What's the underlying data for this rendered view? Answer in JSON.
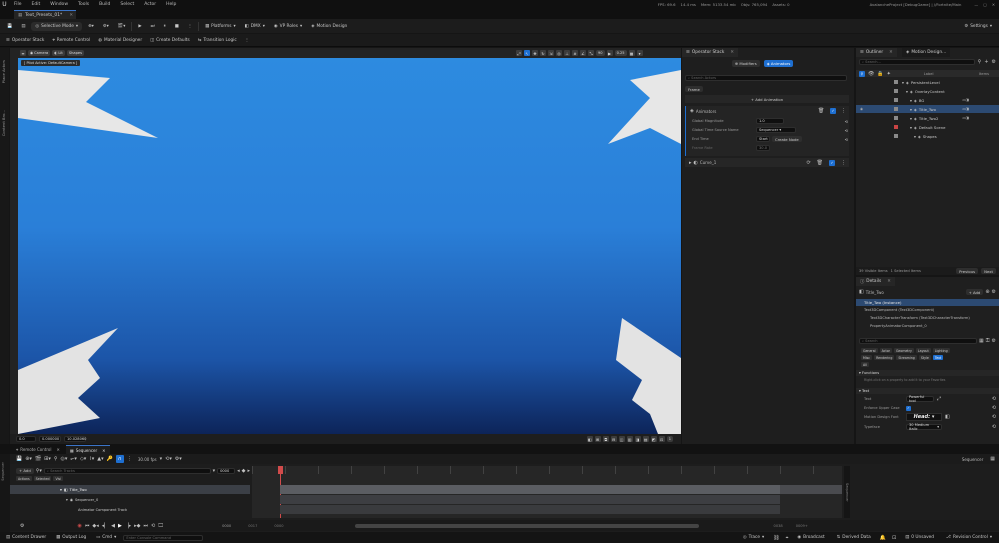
{
  "menubar": {
    "logo": "U",
    "items": [
      "File",
      "Edit",
      "Window",
      "Tools",
      "Build",
      "Select",
      "Actor",
      "Help"
    ],
    "stats": {
      "fps": "FPS: 69.6",
      "ms": "14.4 ms",
      "mem": "Mem: 5133.54 mb",
      "objs": "Objs: 765,094",
      "assets": "Assets: 0"
    },
    "project": "AvalancheProject [DebugGame] | //Fortnite/Main"
  },
  "level_tab": {
    "label": "Text_Presets_01*"
  },
  "toolbar": {
    "selective_mode": "Selective Mode",
    "platforms": "Platforms",
    "dmx": "DMX",
    "vp_roles": "VP Roles",
    "motion_design": "Motion Design",
    "settings": "Settings"
  },
  "toolbar2": {
    "items": [
      "Operator Stack",
      "Remote Control",
      "Material Designer",
      "Create Defaults",
      "Transition Logic"
    ]
  },
  "left_strip": {
    "top": "Place Actors",
    "bottom": "Content Bro..."
  },
  "viewport": {
    "camera_btn": "Camera",
    "lit_btn": "Lit",
    "shapes_btn": "Shapes",
    "pilot_label": "[ Pilot Active: DefaultCamera ]",
    "fov_value": "90",
    "speed_value": "0.25",
    "bottom": {
      "v1": "0.0",
      "v2": "0.000000",
      "v3": "10.028060",
      "zoom": "1"
    }
  },
  "operator_stack": {
    "tab": "Operator Stack",
    "modifiers_btn": "Modifiers",
    "animators_btn": "Animators",
    "search_placeholder": "Search Actors",
    "filter_label": "Frame",
    "add_animation": "+ Add Animation",
    "animators_section": "Animators",
    "global_magnitude_label": "Global Magnitude",
    "global_magnitude_value": "1.0",
    "global_time_source_label": "Global Time Source Name",
    "global_time_source_value": "Sequencer",
    "end_time_label": "End Time",
    "end_time_value": "Start",
    "create_node": "Create Node",
    "frame_rate_label": "Frame Rate",
    "frame_rate_value": "30.0",
    "curve_item": "Curve_1"
  },
  "outliner": {
    "tab1": "Outliner",
    "tab2": "Motion Design...",
    "search_placeholder": "Search...",
    "col_label": "Label",
    "col_items": "Items",
    "rows": [
      {
        "label": "PersistentLevel",
        "indent": 1,
        "selected": false,
        "red": false
      },
      {
        "label": "OverlayContent",
        "indent": 2,
        "selected": false,
        "red": false
      },
      {
        "label": "BG",
        "indent": 3,
        "selected": false,
        "red": false
      },
      {
        "label": "Title_Two",
        "indent": 3,
        "selected": true,
        "red": false
      },
      {
        "label": "Title_Two2",
        "indent": 3,
        "selected": false,
        "red": false
      },
      {
        "label": "Default Scene",
        "indent": 3,
        "selected": false,
        "red": true
      },
      {
        "label": "Shapes",
        "indent": 4,
        "selected": false,
        "red": false
      }
    ],
    "footer_left": "39 Visible Items",
    "footer_mid": "1 Selected Items",
    "prev_btn": "Previous",
    "next_btn": "Next"
  },
  "details": {
    "tab": "Details",
    "actor_name": "Title_Two",
    "add_btn": "+ Add",
    "instance_row": "Title_Two (Instance)",
    "components": [
      "Text3DComponent (Text3DComponent)",
      "Text3DCharacterTransform (Text3DCharacterTransform)",
      "PropertyAnimatorComponent_0"
    ],
    "search_placeholder": "Search",
    "chips_row1": [
      "General",
      "Actor",
      "Geometry",
      "Layout",
      "Lighting"
    ],
    "chips_row2": [
      "Misc",
      "Rendering",
      "Streaming",
      "Style",
      "Text"
    ],
    "chips_row3": [
      "All"
    ],
    "functions_header": "Functions",
    "functions_hint": "Right-click on a property to add it to your Favorites",
    "text_header": "Text",
    "text_label": "Text",
    "text_value": "Powerful tool",
    "enforce_label": "Enforce Upper Case",
    "motion_font_label": "Motion Design Font",
    "motion_font_preview": "Head:",
    "typeface_label": "Typeface",
    "typeface_value": "30 Medium Italic"
  },
  "bottom_tabs": {
    "remote": "Remote Control",
    "sequencer": "Sequencer"
  },
  "sequencer": {
    "fps": "30.00 fps",
    "current_frame": "0000",
    "sequence_name": "Sequencer",
    "add_btn": "+ Add",
    "search_placeholder": "Search Tracks",
    "tags": [
      "Actions",
      "Selected",
      "Visi"
    ],
    "tracks": [
      "Title_Two",
      "Sequencer_0",
      "Animator Component Track"
    ],
    "start_frame": "0000",
    "end_time": "0017",
    "range_start": "0000",
    "range_end": "0038",
    "range_end2": "0009+"
  },
  "statusbar": {
    "content_drawer": "Content Drawer",
    "output_log": "Output Log",
    "cmd": "Cmd",
    "cmd_placeholder": "Enter Console Command",
    "trace": "Trace",
    "broadcast": "Broadcast",
    "derived_data": "Derived Data",
    "unsaved": "0 Unsaved",
    "revision": "Revision Control"
  },
  "colors": {
    "accent": "#1e6fd1",
    "canvas_top": "#2d8be0",
    "canvas_bottom": "#0d2459",
    "playhead": "#d14b4b"
  }
}
